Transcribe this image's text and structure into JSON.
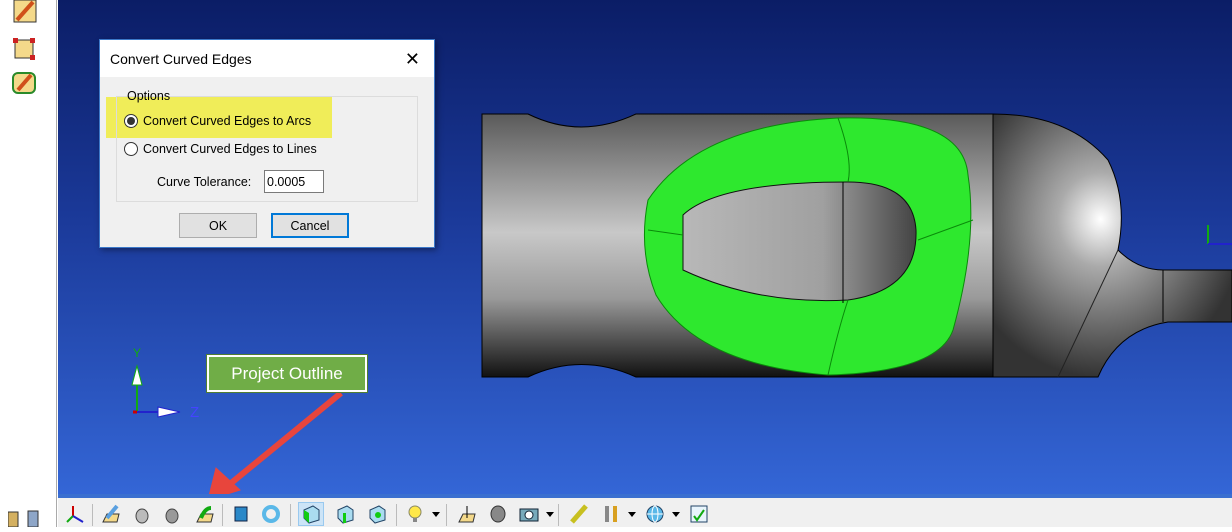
{
  "dialog": {
    "title": "Convert Curved Edges",
    "close_icon": "close-icon",
    "group_label": "Options",
    "options": [
      {
        "label": "Convert Curved Edges to Arcs",
        "selected": true
      },
      {
        "label": "Convert Curved Edges to Lines",
        "selected": false
      }
    ],
    "tolerance_label": "Curve Tolerance:",
    "tolerance_value": "0.0005",
    "ok_label": "OK",
    "cancel_label": "Cancel"
  },
  "callout": {
    "text": "Project Outline"
  },
  "axes": {
    "y": "Y",
    "z": "Z"
  },
  "colors": {
    "highlight": "#f0ec48",
    "callout": "#70ad47",
    "arrow": "#e8453c",
    "part_face": "#2ee82e"
  }
}
